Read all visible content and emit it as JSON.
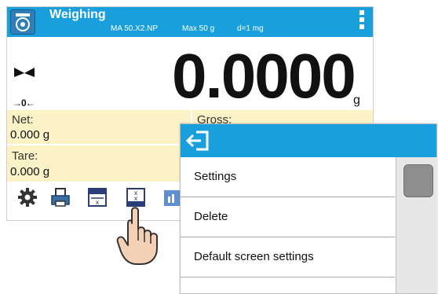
{
  "header": {
    "title": "Weighing",
    "model": "MA 50.X2.NP",
    "max": "Max 50 g",
    "division": "d=1 mg"
  },
  "display": {
    "reading": "0.0000",
    "unit": "g",
    "zero_indicator": "→0←"
  },
  "fields": {
    "net_label": "Net:",
    "net_value": "0.000 g",
    "gross_label": "Gross:",
    "tare_label": "Tare:",
    "tare_value": "0.000 g"
  },
  "toolbar": {
    "icons": [
      "gear-icon",
      "print-icon",
      "tare-icon",
      "function-icon",
      "more-icon"
    ]
  },
  "popup": {
    "items": [
      "Settings",
      "Delete",
      "Default screen settings"
    ]
  },
  "colors": {
    "header": "#19a0dc",
    "field_bg": "#fbf2c7"
  }
}
